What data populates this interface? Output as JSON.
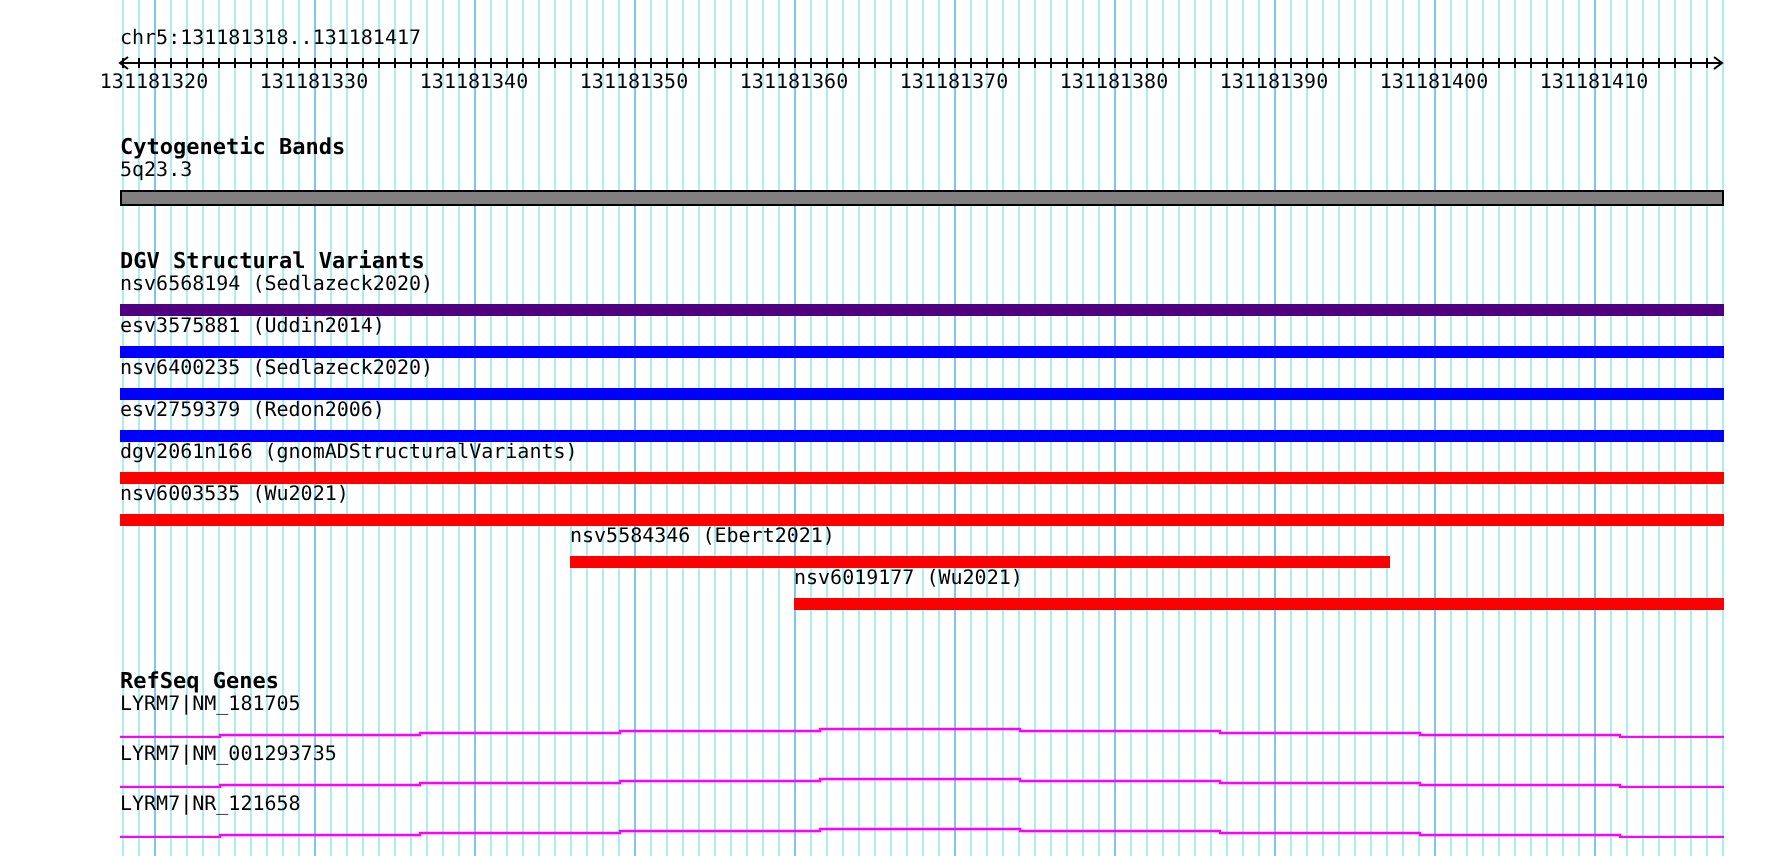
{
  "ruler": {
    "location": "chr5:131181318..131181417",
    "labels": [
      "131181320",
      "131181330",
      "131181340",
      "131181350",
      "131181360",
      "131181370",
      "131181380",
      "131181390",
      "131181400",
      "131181410"
    ]
  },
  "cytogenetic_bands": {
    "title": "Cytogenetic Bands",
    "band": "5q23.3"
  },
  "dgv_structural_variants": {
    "title": "DGV Structural Variants",
    "variants": [
      {
        "label": "nsv6568194 (Sedlazeck2020)",
        "kind": "start",
        "level": 1,
        "color": "#4f0080"
      },
      {
        "label": "esv3575881 (Uddin2014)",
        "kind": "start",
        "level": 1,
        "color": "#0000ff"
      },
      {
        "label": "nsv6400235 (Sedlazeck2020)",
        "kind": "start",
        "level": 1,
        "color": "#0000ff"
      },
      {
        "label": "esv2759379 (Redon2006)",
        "kind": "start",
        "level": 1,
        "color": "#0000ff"
      },
      {
        "label": "dgv2061n166 (gnomADStructuralVariants)",
        "kind": "start",
        "level": 1,
        "color": "#ff0000"
      },
      {
        "label": "nsv6003535 (Wu2021)",
        "kind": "start",
        "level": 1,
        "color": "#ff0000"
      },
      {
        "label": "nsv5584346 (Ebert2021)",
        "kind": "inset",
        "span": {
          "level": 0.72
        },
        "level": 0.71,
        "color": "#ff0000"
      },
      {
        "label": "nsv6019177 (Wu2021)",
        "kind": "end",
        "level": 0.58,
        "color": "#ff0000"
      }
    ]
  },
  "refseq_genes": {
    "title": "RefSeq Genes",
    "transcripts": [
      {
        "label": "LYRM7|NM_181705"
      },
      {
        "label": "LYRM7|NM_001293735"
      },
      {
        "label": "LYRM7|NR_121658"
      }
    ]
  }
}
